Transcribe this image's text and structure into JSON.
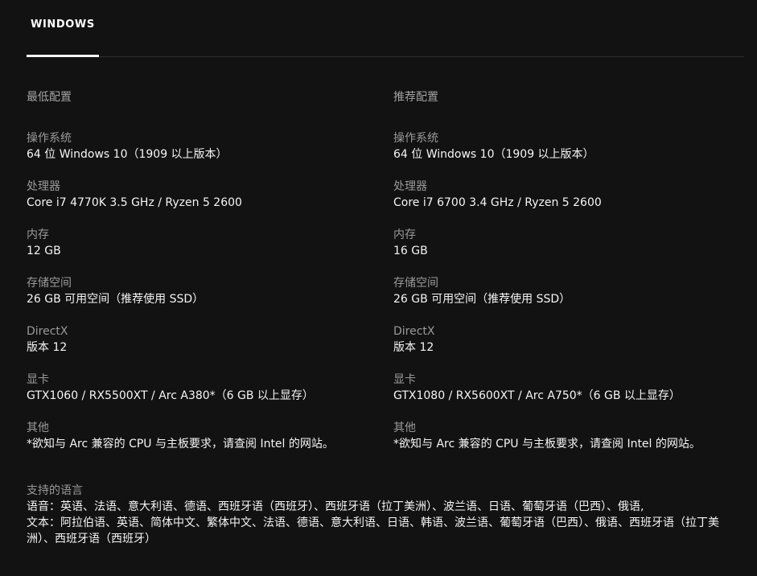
{
  "tabs": [
    {
      "label": "WINDOWS",
      "active": true
    }
  ],
  "minimum": {
    "heading": "最低配置",
    "specs": [
      {
        "label": "操作系统",
        "value": "64 位 Windows 10（1909 以上版本）"
      },
      {
        "label": "处理器",
        "value": "Core i7 4770K 3.5 GHz / Ryzen 5 2600"
      },
      {
        "label": "内存",
        "value": "12 GB"
      },
      {
        "label": "存储空间",
        "value": "26 GB 可用空间（推荐使用 SSD）"
      },
      {
        "label": "DirectX",
        "value": "版本 12"
      },
      {
        "label": "显卡",
        "value": "GTX1060 / RX5500XT / Arc A380*（6 GB 以上显存）"
      },
      {
        "label": "其他",
        "value": "*欲知与 Arc 兼容的 CPU 与主板要求，请查阅 Intel 的网站。"
      }
    ]
  },
  "recommended": {
    "heading": "推荐配置",
    "specs": [
      {
        "label": "操作系统",
        "value": "64 位 Windows 10（1909 以上版本）"
      },
      {
        "label": "处理器",
        "value": "Core i7 6700 3.4 GHz / Ryzen 5 2600"
      },
      {
        "label": "内存",
        "value": "16 GB"
      },
      {
        "label": "存储空间",
        "value": "26 GB 可用空间（推荐使用 SSD）"
      },
      {
        "label": "DirectX",
        "value": "版本 12"
      },
      {
        "label": "显卡",
        "value": "GTX1080 / RX5600XT / Arc A750*（6 GB 以上显存）"
      },
      {
        "label": "其他",
        "value": "*欲知与 Arc 兼容的 CPU 与主板要求，请查阅 Intel 的网站。"
      }
    ]
  },
  "languages": {
    "heading": "支持的语言",
    "audio": "语音：英语、法语、意大利语、德语、西班牙语（西班牙）、西班牙语（拉丁美洲）、波兰语、日语、葡萄牙语（巴西）、俄语,",
    "text": "文本：阿拉伯语、英语、简体中文、繁体中文、法语、德语、意大利语、日语、韩语、波兰语、葡萄牙语（巴西）、俄语、西班牙语（拉丁美洲）、西班牙语（西班牙）"
  }
}
